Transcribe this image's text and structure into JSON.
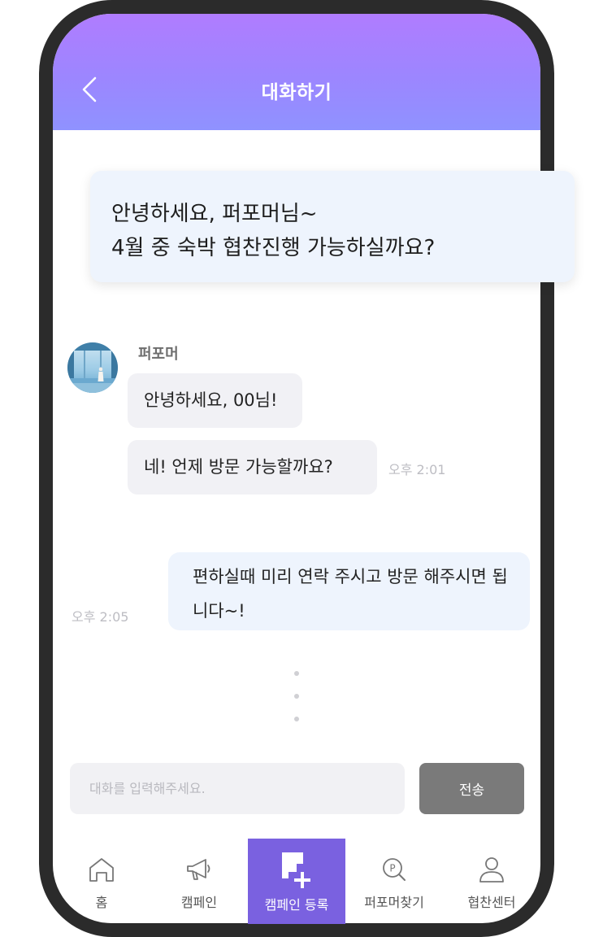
{
  "header": {
    "title": "대화하기"
  },
  "featured_message": {
    "line1": "안녕하세요, 퍼포머님~",
    "line2": "4월 중 숙박 협찬진행 가능하실까요?"
  },
  "conversation": {
    "sender_name": "퍼포머",
    "incoming": [
      {
        "text": "안녕하세요, 00님!"
      },
      {
        "text": "네! 언제 방문 가능할까요?",
        "time": "오후 2:01"
      }
    ],
    "outgoing": {
      "text": "편하실때 미리 연락 주시고 방문 해주시면 됩니다~!",
      "time": "오후 2:05"
    }
  },
  "composer": {
    "placeholder": "대화를 입력해주세요.",
    "value": "",
    "send_label": "전송"
  },
  "tabbar": {
    "items": [
      {
        "label": "홈",
        "icon": "home-icon"
      },
      {
        "label": "캠페인",
        "icon": "megaphone-icon"
      },
      {
        "label": "캠페인 등록",
        "icon": "campaign-add-icon",
        "active": true
      },
      {
        "label": "퍼포머찾기",
        "icon": "performer-search-icon"
      },
      {
        "label": "협찬센터",
        "icon": "user-icon"
      }
    ]
  },
  "colors": {
    "header_gradient_top": "#b07cff",
    "header_gradient_bottom": "#8f92ff",
    "active_tab": "#7a61e0",
    "send_button": "#7a7a7a",
    "incoming_bubble": "#f1f1f5",
    "outgoing_bubble": "#eef4fd"
  }
}
